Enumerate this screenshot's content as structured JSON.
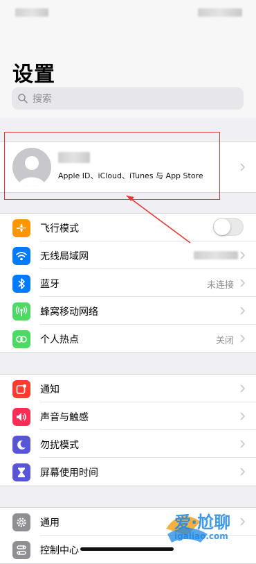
{
  "page": {
    "title": "设置"
  },
  "search": {
    "placeholder": "搜索"
  },
  "profile": {
    "subtitle": "Apple ID、iCloud、iTunes 与 App Store"
  },
  "group1": [
    {
      "label": "飞行模式",
      "icon": "airplane-icon",
      "color": "#ff9500",
      "value": "",
      "toggle": false
    },
    {
      "label": "无线局域网",
      "icon": "wifi-icon",
      "color": "#007aff",
      "value": ""
    },
    {
      "label": "蓝牙",
      "icon": "bluetooth-icon",
      "color": "#007aff",
      "value": "未连接"
    },
    {
      "label": "蜂窝移动网络",
      "icon": "cellular-icon",
      "color": "#4cd964",
      "value": ""
    },
    {
      "label": "个人热点",
      "icon": "hotspot-icon",
      "color": "#4cd964",
      "value": "关闭"
    }
  ],
  "group2": [
    {
      "label": "通知",
      "icon": "notifications-icon",
      "color": "#ff3b30"
    },
    {
      "label": "声音与触感",
      "icon": "sound-icon",
      "color": "#ff2d55"
    },
    {
      "label": "勿扰模式",
      "icon": "moon-icon",
      "color": "#5856d6"
    },
    {
      "label": "屏幕使用时间",
      "icon": "hourglass-icon",
      "color": "#5856d6"
    }
  ],
  "group3": [
    {
      "label": "通用",
      "icon": "gear-icon",
      "color": "#8e8e93"
    },
    {
      "label": "控制中心",
      "icon": "control-center-icon",
      "color": "#8e8e93"
    }
  ],
  "watermark": {
    "text": "爱·尬聊",
    "url": "igaliao.com"
  }
}
